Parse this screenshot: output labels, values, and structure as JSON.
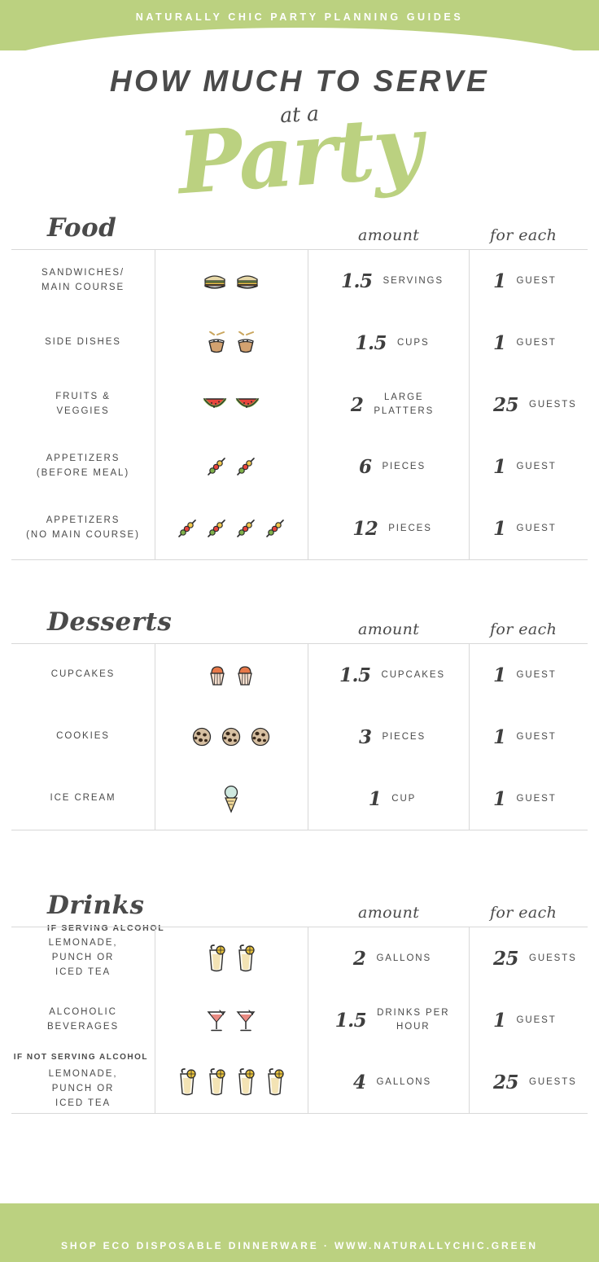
{
  "header": {
    "banner_text": "NATURALLY CHIC PARTY PLANNING GUIDES",
    "title_line1": "HOW MUCH TO SERVE",
    "title_line2": "at a",
    "title_line3": "Party"
  },
  "colors": {
    "green": "#bbd180",
    "text": "#4a4a4a",
    "rule": "#d8d8d8"
  },
  "columns": {
    "amount": "amount",
    "for_each": "for each"
  },
  "sections": [
    {
      "title": "Food",
      "subtitle": "",
      "rows": [
        {
          "label": "SANDWICHES/\nMAIN COURSE",
          "icon": "sandwich-icon",
          "icon_count": 2,
          "amount": "1.5",
          "unit": "SERVINGS",
          "each_number": "1",
          "each_unit": "GUEST",
          "tag": ""
        },
        {
          "label": "SIDE DISHES",
          "icon": "side-dish-bowl-icon",
          "icon_count": 2,
          "amount": "1.5",
          "unit": "CUPS",
          "each_number": "1",
          "each_unit": "GUEST",
          "tag": ""
        },
        {
          "label": "FRUITS &\nVEGGIES",
          "icon": "watermelon-icon",
          "icon_count": 2,
          "amount": "2",
          "unit": "LARGE\nPLATTERS",
          "each_number": "25",
          "each_unit": "GUESTS",
          "tag": ""
        },
        {
          "label": "APPETIZERS\n(BEFORE MEAL)",
          "icon": "skewer-icon",
          "icon_count": 2,
          "amount": "6",
          "unit": "PIECES",
          "each_number": "1",
          "each_unit": "GUEST",
          "tag": ""
        },
        {
          "label": "APPETIZERS\n(NO MAIN COURSE)",
          "icon": "skewer-icon",
          "icon_count": 4,
          "amount": "12",
          "unit": "PIECES",
          "each_number": "1",
          "each_unit": "GUEST",
          "tag": ""
        }
      ]
    },
    {
      "title": "Desserts",
      "subtitle": "",
      "rows": [
        {
          "label": "CUPCAKES",
          "icon": "cupcake-icon",
          "icon_count": 2,
          "amount": "1.5",
          "unit": "CUPCAKES",
          "each_number": "1",
          "each_unit": "GUEST",
          "tag": ""
        },
        {
          "label": "COOKIES",
          "icon": "cookie-icon",
          "icon_count": 3,
          "amount": "3",
          "unit": "PIECES",
          "each_number": "1",
          "each_unit": "GUEST",
          "tag": ""
        },
        {
          "label": "ICE CREAM",
          "icon": "ice-cream-cone-icon",
          "icon_count": 1,
          "amount": "1",
          "unit": "CUP",
          "each_number": "1",
          "each_unit": "GUEST",
          "tag": ""
        }
      ]
    },
    {
      "title": "Drinks",
      "subtitle": "IF SERVING ALCOHOL",
      "rows": [
        {
          "label": "LEMONADE,\nPUNCH OR\nICED TEA",
          "icon": "lemonade-glass-icon",
          "icon_count": 2,
          "amount": "2",
          "unit": "GALLONS",
          "each_number": "25",
          "each_unit": "GUESTS",
          "tag": ""
        },
        {
          "label": "ALCOHOLIC\nBEVERAGES",
          "icon": "cocktail-glass-icon",
          "icon_count": 2,
          "amount": "1.5",
          "unit": "DRINKS PER\nHOUR",
          "each_number": "1",
          "each_unit": "GUEST",
          "tag": ""
        },
        {
          "label": "LEMONADE,\nPUNCH OR\nICED TEA",
          "icon": "lemonade-glass-icon",
          "icon_count": 4,
          "amount": "4",
          "unit": "GALLONS",
          "each_number": "25",
          "each_unit": "GUESTS",
          "tag": "IF NOT SERVING ALCOHOL"
        }
      ]
    }
  ],
  "footer": {
    "text": "SHOP ECO DISPOSABLE DINNERWARE · WWW.NATURALLYCHIC.GREEN"
  }
}
